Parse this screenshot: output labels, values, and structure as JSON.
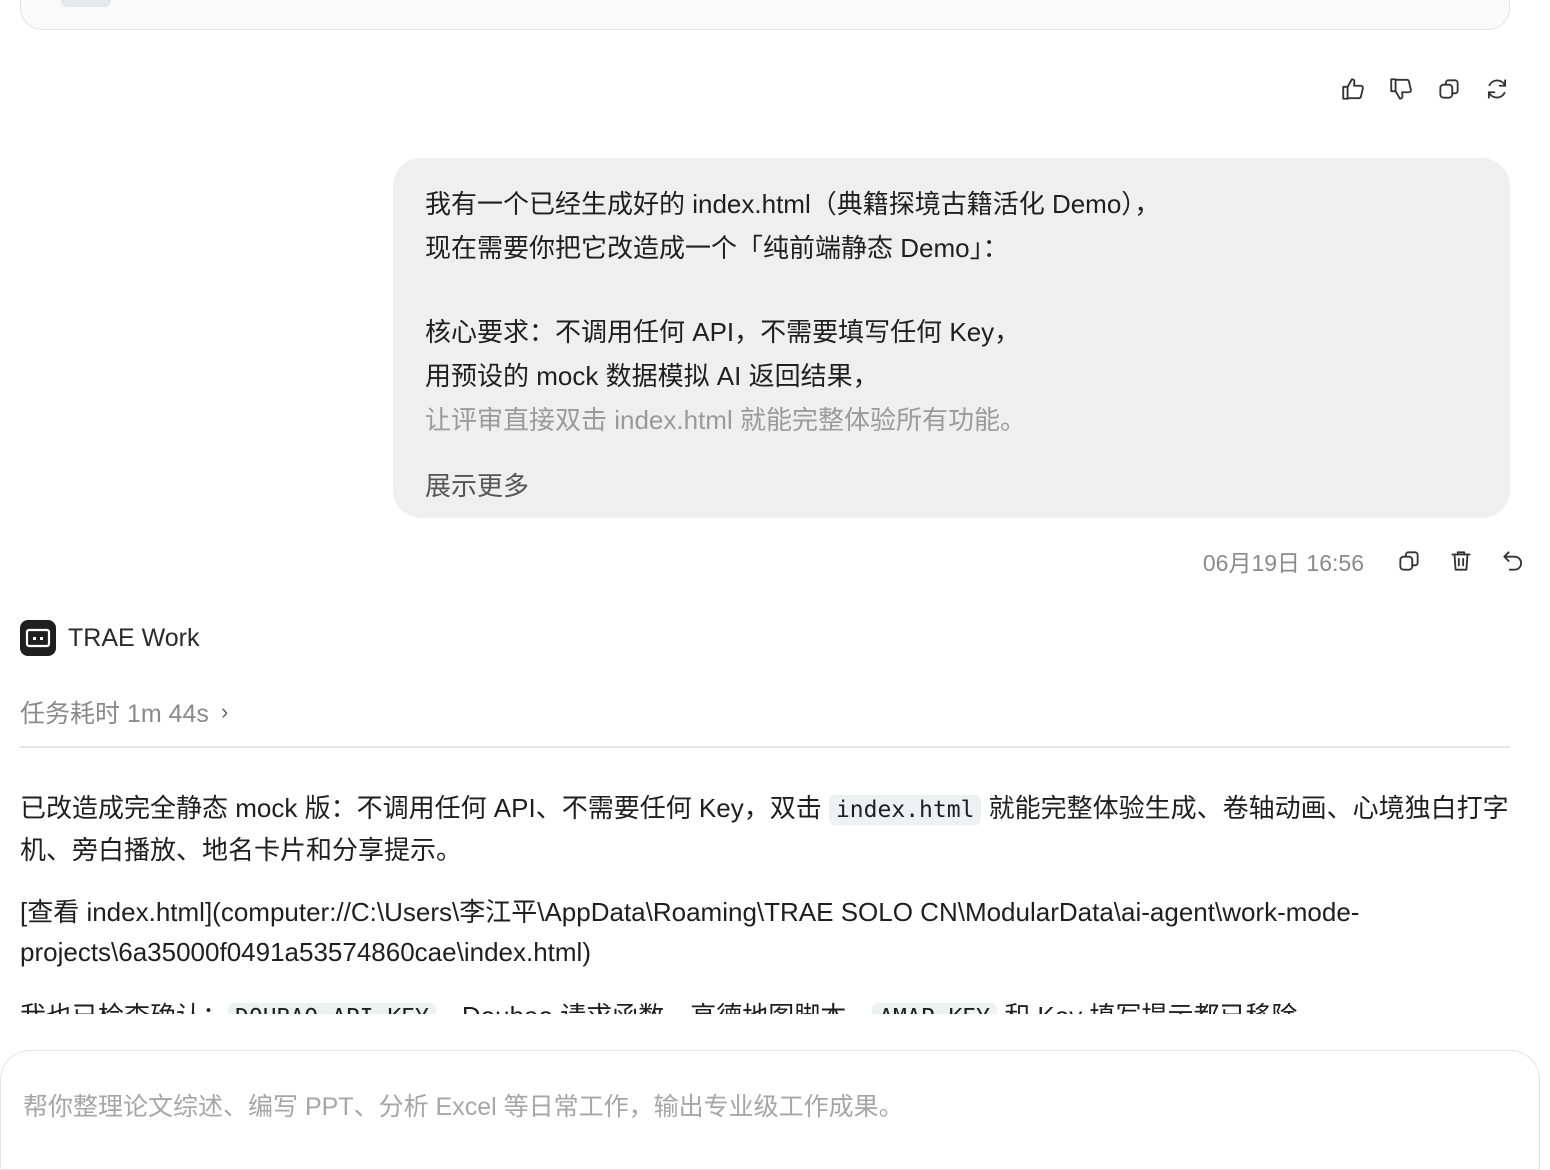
{
  "message_actions": {
    "like_label": "like",
    "dislike_label": "dislike",
    "copy_label": "copy",
    "regenerate_label": "regenerate"
  },
  "user_message": {
    "lines": [
      "我有一个已经生成好的 index.html（典籍探境古籍活化 Demo），",
      "现在需要你把它改造成一个「纯前端静态 Demo」：",
      "",
      "核心要求：不调用任何 API，不需要填写任何 Key，",
      "用预设的 mock 数据模拟 AI 返回结果，",
      "让评审直接双击 index.html 就能完整体验所有功能。"
    ],
    "show_more": "展示更多",
    "timestamp": "06月19日 16:56"
  },
  "agent": {
    "name": "TRAE Work",
    "task_time": "任务耗时 1m 44s",
    "reply": {
      "p1_before": "已改造成完全静态 mock 版：不调用任何 API、不需要任何 Key，双击 ",
      "p1_code": "index.html",
      "p1_after": " 就能完整体验生成、卷轴动画、心境独白打字机、旁白播放、地名卡片和分享提示。",
      "p2": "[查看 index.html](computer://C:\\Users\\李江平\\AppData\\Roaming\\TRAE SOLO CN\\ModularData\\ai-agent\\work-mode-projects\\6a35000f0491a53574860cae\\index.html)",
      "p3_before": "我也已检查确认：",
      "p3_code1": "DOUBAO_API_KEY",
      "p3_mid": "、Doubao 请求函数、高德地图脚本、",
      "p3_code2": "AMAP_KEY",
      "p3_after": " 和 Key 填写提示都已移除。"
    }
  },
  "composer": {
    "placeholder": "帮你整理论文综述、编写 PPT、分析 Excel 等日常工作，输出专业级工作成果。"
  }
}
